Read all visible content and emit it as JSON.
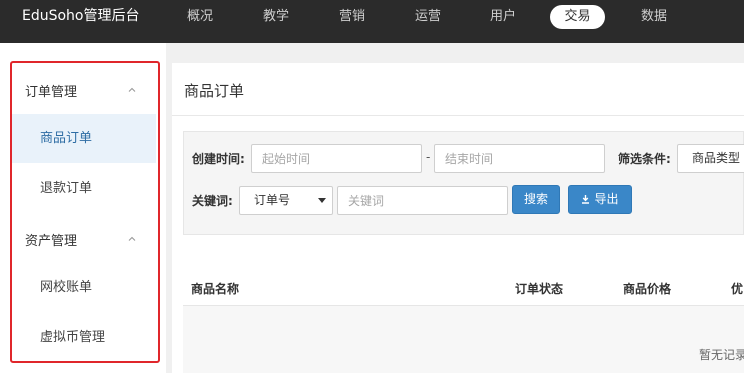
{
  "header": {
    "brand": "EduSoho管理后台",
    "nav": [
      {
        "label": "概况"
      },
      {
        "label": "教学"
      },
      {
        "label": "营销"
      },
      {
        "label": "运营"
      },
      {
        "label": "用户"
      },
      {
        "label": "交易",
        "active": true
      },
      {
        "label": "数据"
      }
    ]
  },
  "sidebar": {
    "groups": [
      {
        "label": "订单管理",
        "items": [
          {
            "label": "商品订单",
            "active": true
          },
          {
            "label": "退款订单"
          }
        ]
      },
      {
        "label": "资产管理",
        "items": [
          {
            "label": "网校账单"
          },
          {
            "label": "虚拟币管理"
          }
        ]
      }
    ]
  },
  "main": {
    "title": "商品订单",
    "filters": {
      "created_label": "创建时间:",
      "start_placeholder": "起始时间",
      "end_placeholder": "结束时间",
      "range_sep": "-",
      "filter_label": "筛选条件:",
      "filter_select": "商品类型",
      "keyword_label": "关键词:",
      "keyword_select": "订单号",
      "keyword_placeholder": "关键词",
      "search_button": "搜索",
      "export_button": "导出"
    },
    "table": {
      "columns": [
        "商品名称",
        "订单状态",
        "商品价格",
        "优"
      ],
      "empty_text": "暂无记录"
    }
  },
  "colors": {
    "topbar": "#2b2b2b",
    "highlight_outline": "#e0262b",
    "primary_button": "#3a87c8",
    "active_sidebar_bg": "#e9f2fa"
  },
  "icons": {
    "group_toggle": "chevron-up-icon",
    "select_caret": "caret-down-icon",
    "export": "download-icon"
  }
}
